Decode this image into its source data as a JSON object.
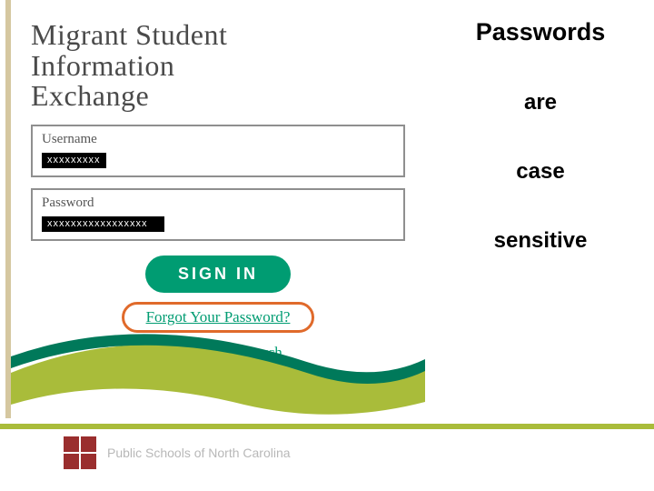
{
  "login": {
    "title_line1": "Migrant Student",
    "title_line2": "Information",
    "title_line3": "Exchange",
    "username_label": "Username",
    "username_value": "xxxxxxxxx",
    "password_label": "Password",
    "password_value": "xxxxxxxxxxxxxxxxx",
    "signin_label": "SIGN IN",
    "forgot_label": "Forgot Your Password?",
    "state_contact_label": "State Contact Search"
  },
  "reminder": {
    "w1": "Passwords",
    "w2": "are",
    "w3": "case",
    "w4": "sensitive"
  },
  "footer": {
    "org": "Public Schools of North Carolina"
  },
  "colors": {
    "accent_green": "#009c72",
    "lime": "#a9bc3a",
    "highlight_orange": "#e06a2b",
    "footer_logo": "#9a2e2e"
  }
}
